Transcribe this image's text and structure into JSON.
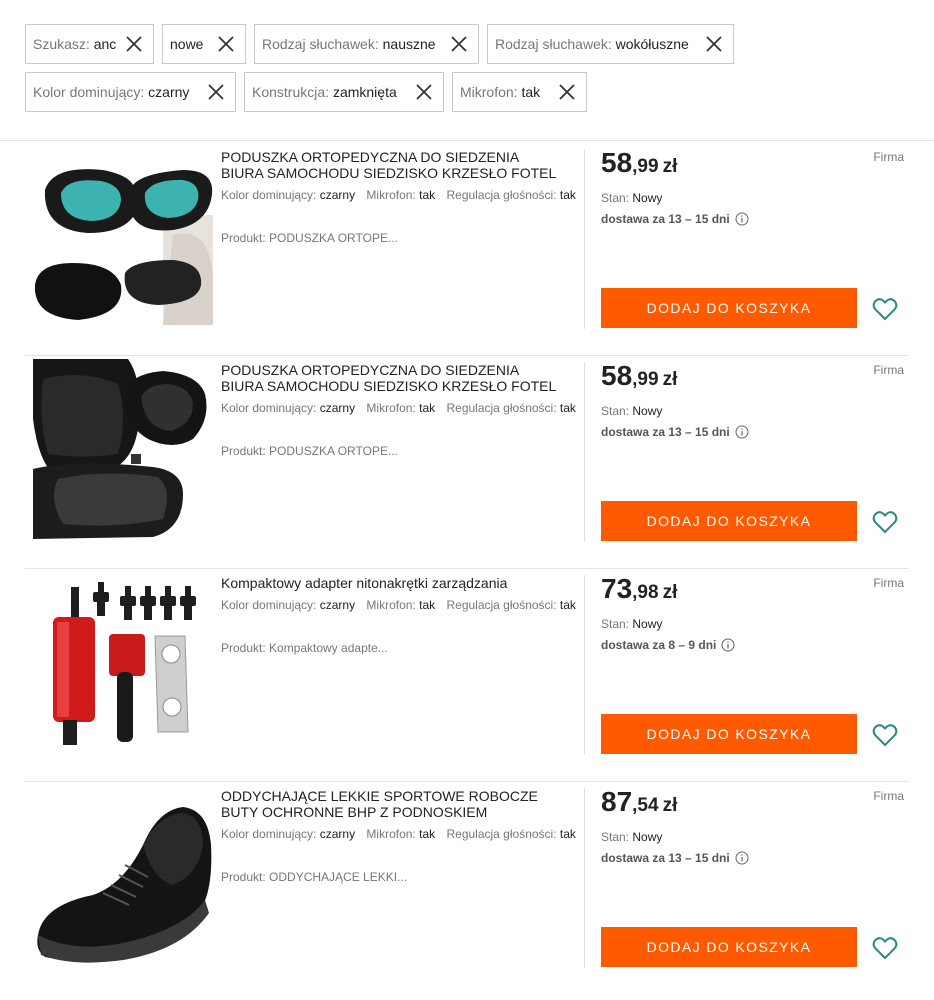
{
  "filters": [
    {
      "key": "Szukasz:",
      "value": "anc"
    },
    {
      "key": "",
      "value": "nowe"
    },
    {
      "key": "Rodzaj słuchawek:",
      "value": "nauszne"
    },
    {
      "key": "Rodzaj słuchawek:",
      "value": "wokółuszne"
    },
    {
      "key": "Kolor dominujący:",
      "value": "czarny"
    },
    {
      "key": "Konstrukcja:",
      "value": "zamknięta"
    },
    {
      "key": "Mikrofon:",
      "value": "tak"
    }
  ],
  "listing_labels": {
    "color_key": "Kolor dominujący:",
    "mic_key": "Mikrofon:",
    "volume_key": "Regulacja głośności:",
    "condition_key": "Stan:",
    "add_to_cart": "DODAJ DO KOSZYKA",
    "seller_type": "Firma",
    "currency": "zł"
  },
  "listings": [
    {
      "title": "PODUSZKA ORTOPEDYCZNA DO SIEDZENIA BIURA SAMOCHODU SIEDZISKO KRZESŁO FOTEL",
      "color": "czarny",
      "mic": "tak",
      "volume": "tak",
      "product": "Produkt: PODUSZKA ORTOPE...",
      "price_whole": "58",
      "price_decimal": ",99",
      "condition": "Nowy",
      "delivery": "dostawa za 13 – 15 dni",
      "image": "seat-cushion-gel-icon"
    },
    {
      "title": "PODUSZKA ORTOPEDYCZNA DO SIEDZENIA BIURA SAMOCHODU SIEDZISKO KRZESŁO FOTEL",
      "color": "czarny",
      "mic": "tak",
      "volume": "tak",
      "product": "Produkt: PODUSZKA ORTOPE...",
      "price_whole": "58",
      "price_decimal": ",99",
      "condition": "Nowy",
      "delivery": "dostawa za 13 – 15 dni",
      "image": "car-seat-cushion-icon"
    },
    {
      "title": "Kompaktowy adapter nitonakrętki zarządzania",
      "color": "czarny",
      "mic": "tak",
      "volume": "tak",
      "product": "Produkt: Kompaktowy adapte...",
      "price_whole": "73",
      "price_decimal": ",98",
      "condition": "Nowy",
      "delivery": "dostawa za 8 – 9 dni",
      "image": "rivet-nut-adapter-icon"
    },
    {
      "title": "ODDYCHAJĄCE LEKKIE SPORTOWE ROBOCZE BUTY OCHRONNE BHP Z PODNOSKIEM",
      "color": "czarny",
      "mic": "tak",
      "volume": "tak",
      "product": "Produkt: ODDYCHAJĄCE LEKKI...",
      "price_whole": "87",
      "price_decimal": ",54",
      "condition": "Nowy",
      "delivery": "dostawa za 13 – 15 dni",
      "image": "safety-shoe-icon"
    }
  ],
  "colors": {
    "accent": "#ff5a00",
    "heart": "#2a8a7f"
  }
}
